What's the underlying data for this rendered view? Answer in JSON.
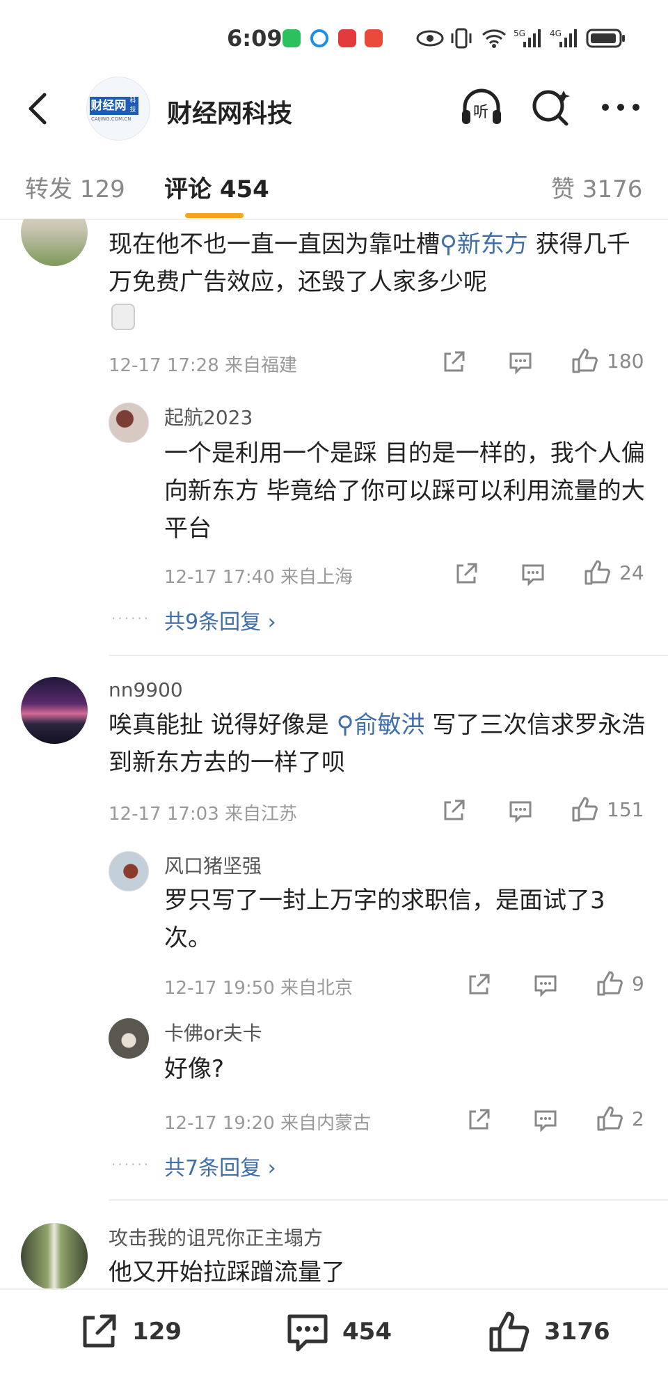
{
  "status_bar": {
    "time": "6:09"
  },
  "header": {
    "account_name": "财经网科技",
    "logo_text": "财经网",
    "logo_side": "科技",
    "logo_sub": "CAIJING.COM.CN",
    "listen_label": "听"
  },
  "tabs": [
    {
      "label": "转发 129"
    },
    {
      "label": "评论 454"
    },
    {
      "label": "赞 3176"
    }
  ],
  "comments": [
    {
      "text_before": "现在他不也一直一直因为靠吐槽",
      "tag": "新东方",
      "text_after": "获得几千万免费广告效应，还毁了人家多少呢",
      "meta": "12-17 17:28 来自福建",
      "likes": "180",
      "reply": {
        "user": "起航2023",
        "text": "一个是利用一个是踩 目的是一样的，我个人偏向新东方 毕竟给了你可以踩可以利用流量的大平台",
        "meta": "12-17 17:40 来自上海",
        "likes": "24"
      },
      "more": "共9条回复 ›"
    },
    {
      "user": "nn9900",
      "text_before": "唉真能扯 说得好像是",
      "tag": "俞敏洪",
      "text_after": "写了三次信求罗永浩到新东方去的一样了呗",
      "meta": "12-17 17:03 来自江苏",
      "likes": "151",
      "replies": [
        {
          "user": "风口猪坚强",
          "text": "罗只写了一封上万字的求职信，是面试了3次。",
          "meta": "12-17 19:50 来自北京",
          "likes": "9"
        },
        {
          "user": "卡佛or夫卡",
          "text": "好像?",
          "meta": "12-17 19:20 来自内蒙古",
          "likes": "2"
        }
      ],
      "more": "共7条回复 ›"
    },
    {
      "user": "攻击我的诅咒你正主塌方",
      "text": "他又开始拉踩蹭流量了"
    }
  ],
  "bottom_bar": {
    "reposts": "129",
    "comments": "454",
    "likes": "3176"
  },
  "colors": {
    "accent": "#f4a51c",
    "link": "#3f6ea8",
    "verify": "#2c91e8"
  }
}
